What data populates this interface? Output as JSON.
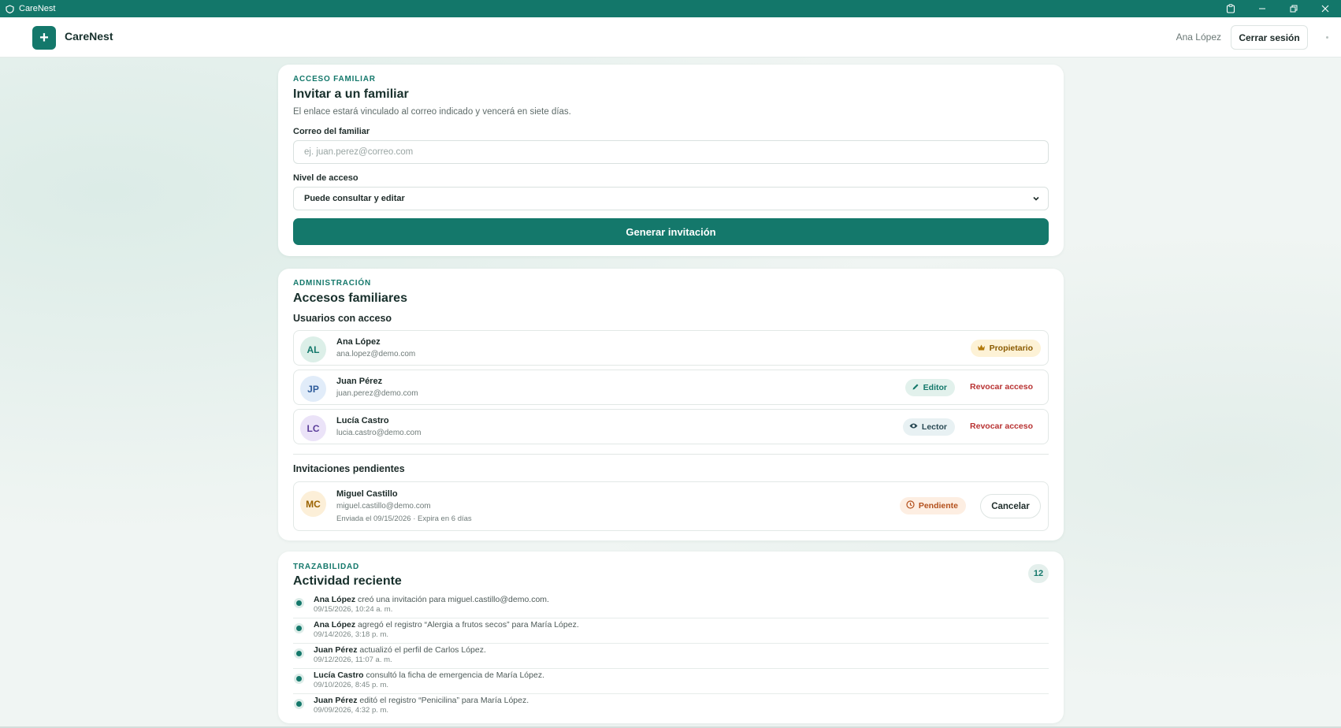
{
  "window": {
    "title": "CareNest"
  },
  "header": {
    "brand": "CareNest",
    "logo_symbol": "+",
    "user_name": "Ana López",
    "logout_label": "Cerrar sesión"
  },
  "invite": {
    "eyebrow": "ACCESO FAMILIAR",
    "title": "Invitar a un familiar",
    "description": "El enlace estará vinculado al correo indicado y vencerá en siete días.",
    "email_label": "Correo del familiar",
    "email_placeholder": "ej. juan.perez@correo.com",
    "email_value": "",
    "access_label": "Nivel de acceso",
    "access_value": "Puede consultar y editar",
    "submit_label": "Generar invitación"
  },
  "access": {
    "eyebrow": "ADMINISTRACIÓN",
    "title": "Accesos familiares",
    "users_heading": "Usuarios con acceso",
    "users": [
      {
        "initials": "AL",
        "name": "Ana López",
        "email": "ana.lopez@demo.com",
        "role": "Propietario",
        "role_icon": "crown-icon",
        "revoke": ""
      },
      {
        "initials": "JP",
        "name": "Juan Pérez",
        "email": "juan.perez@demo.com",
        "role": "Editor",
        "role_icon": "pencil-icon",
        "revoke": "Revocar acceso"
      },
      {
        "initials": "LC",
        "name": "Lucía Castro",
        "email": "lucia.castro@demo.com",
        "role": "Lector",
        "role_icon": "eye-icon",
        "revoke": "Revocar acceso"
      }
    ],
    "pending_heading": "Invitaciones pendientes",
    "pending": {
      "initials": "MC",
      "name": "Miguel Castillo",
      "email": "miguel.castillo@demo.com",
      "meta": "Enviada el 09/15/2026 · Expira en 6 días",
      "status": "Pendiente",
      "cancel_label": "Cancelar"
    }
  },
  "activity": {
    "eyebrow": "TRAZABILIDAD",
    "title": "Actividad reciente",
    "count": "12",
    "items": [
      {
        "actor": "Ana López",
        "text": " creó una invitación para miguel.castillo@demo.com.",
        "time": "09/15/2026, 10:24 a. m."
      },
      {
        "actor": "Ana López",
        "text": " agregó el registro “Alergia a frutos secos” para María López.",
        "time": "09/14/2026, 3:18 p. m."
      },
      {
        "actor": "Juan Pérez",
        "text": " actualizó el perfil de Carlos López.",
        "time": "09/12/2026, 11:07 a. m."
      },
      {
        "actor": "Lucía Castro",
        "text": " consultó la ficha de emergencia de María López.",
        "time": "09/10/2026, 8:45 p. m."
      },
      {
        "actor": "Juan Pérez",
        "text": " editó el registro “Penicilina” para María López.",
        "time": "09/09/2026, 4:32 p. m."
      }
    ]
  },
  "colors": {
    "brand": "#14786b",
    "danger": "#b83232",
    "owner_badge_bg": "#fdf2d6",
    "pending_badge_bg": "#fdeee2"
  }
}
